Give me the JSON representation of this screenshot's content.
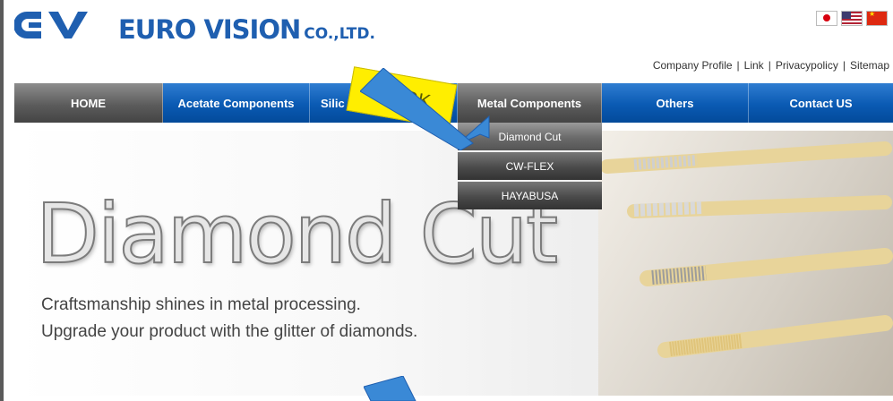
{
  "header": {
    "brand": "EURO VISION",
    "brand_suffix": "CO.,LTD.",
    "languages": [
      "japanese-flag-icon",
      "english-flag-icon",
      "chinese-flag-icon"
    ]
  },
  "toplinks": {
    "items": [
      "Company Profile",
      "Link",
      "Privacypolicy",
      "Sitemap"
    ],
    "separator": "|"
  },
  "nav": {
    "items": [
      {
        "label": "HOME",
        "style": "gray"
      },
      {
        "label": "Acetate Components",
        "style": "blue"
      },
      {
        "label": "Silic",
        "style": "blue"
      },
      {
        "label": "Metal Components",
        "style": "gray"
      },
      {
        "label": "Others",
        "style": "blue"
      },
      {
        "label": "Contact US",
        "style": "blue"
      }
    ]
  },
  "dropdown": {
    "items": [
      "Diamond Cut",
      "CW-FLEX",
      "HAYABUSA"
    ]
  },
  "hero": {
    "title": "Diamond Cut",
    "line1": "Craftsmanship shines in metal processing.",
    "line2": "Upgrade your product with the glitter of diamonds."
  },
  "overlay": {
    "click_label": "CLICK"
  },
  "colors": {
    "brand_blue": "#1f5fb0",
    "nav_blue": "#0a5ab3",
    "nav_gray": "#5c5c5c",
    "click_yellow": "#ffee00",
    "arrow_blue": "#3a89d6"
  }
}
